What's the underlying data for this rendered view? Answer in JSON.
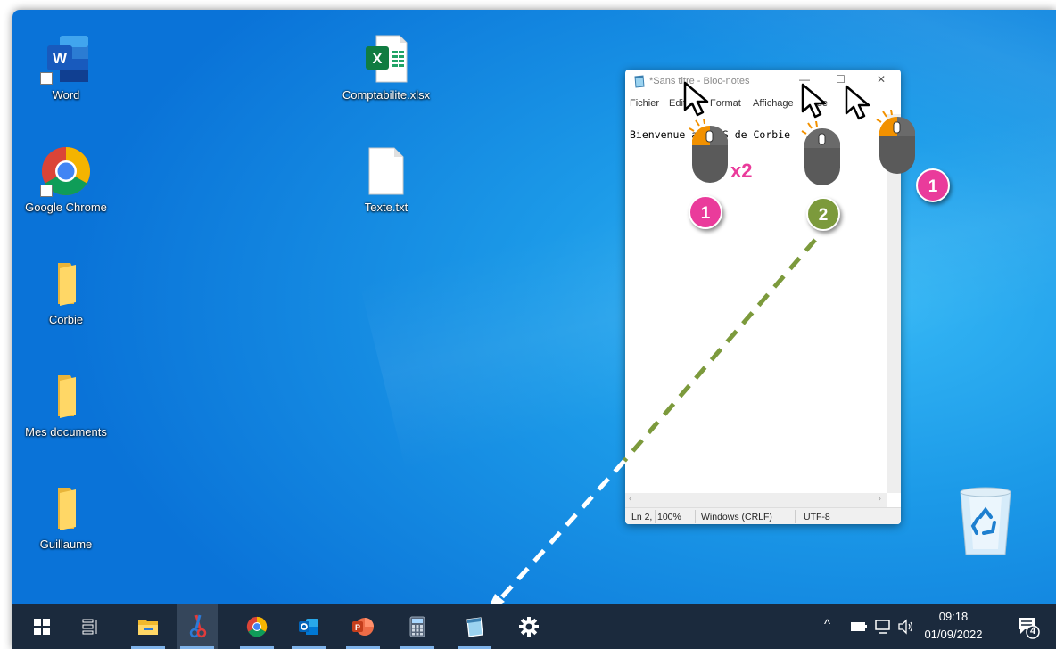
{
  "desktop": {
    "icons": [
      {
        "label": "Word"
      },
      {
        "label": "Google Chrome"
      },
      {
        "label": "Corbie"
      },
      {
        "label": "Mes documents"
      },
      {
        "label": "Guillaume"
      },
      {
        "label": "Comptabilite.xlsx"
      },
      {
        "label": "Texte.txt"
      }
    ]
  },
  "notepad": {
    "title": "*Sans titre - Bloc-notes",
    "controls": {
      "minimize": "—",
      "maximize": "☐",
      "close": "✕"
    },
    "menu": [
      "Fichier",
      "Edition",
      "Format",
      "Affichage",
      "Aide"
    ],
    "content": "Bienvenue au CAS de Corbie",
    "status": {
      "position": "Ln 2,",
      "zoom": "100%",
      "eol": "Windows (CRLF)",
      "encoding": "UTF-8"
    }
  },
  "annotations": {
    "multiplier": "x2",
    "badge_left": "1",
    "badge_middle": "2",
    "badge_right": "1"
  },
  "taskbar": {
    "apps": [
      "start-icon",
      "task-view-icon",
      "file-explorer-icon",
      "snipping-tool-icon",
      "chrome-icon",
      "outlook-icon",
      "powerpoint-icon",
      "calculator-icon",
      "notepad-icon",
      "settings-icon"
    ],
    "clock": {
      "time": "09:18",
      "date": "01/09/2022"
    },
    "notifications": "4"
  },
  "colors": {
    "badge_pink": "#ea3b9b",
    "badge_green": "#7c9a3c",
    "mouse_button": "#f29100",
    "taskbar": "#1b2a3d"
  }
}
